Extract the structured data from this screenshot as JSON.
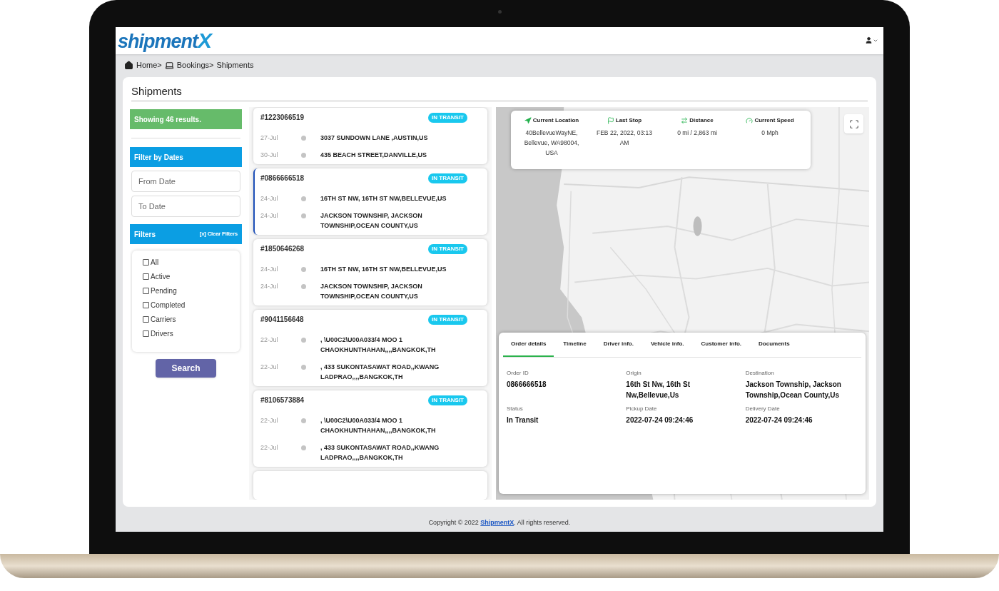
{
  "logo": {
    "text": "shipment",
    "accent": "X"
  },
  "breadcrumb": [
    {
      "kind": "home",
      "label": "Home>"
    },
    {
      "kind": "laptop",
      "label": "Bookings>"
    },
    {
      "kind": "text",
      "label": "Shipments"
    }
  ],
  "page_title": "Shipments",
  "results_banner": "Showing 46 results.",
  "date_filter": {
    "title": "Filter by Dates",
    "fields": [
      {
        "placeholder": "From Date"
      },
      {
        "placeholder": "To Date"
      }
    ]
  },
  "filters": {
    "title": "Filters",
    "clear_link": "[x] Clear Filters",
    "options": [
      {
        "label": "All",
        "checked": false
      },
      {
        "label": "Active",
        "checked": false
      },
      {
        "label": "Pending",
        "checked": false
      },
      {
        "label": "Completed",
        "checked": false
      },
      {
        "label": "Carriers",
        "checked": false
      },
      {
        "label": "Drivers",
        "checked": false
      }
    ]
  },
  "search_button": "Search",
  "shipments": [
    {
      "id": "#1223066519",
      "status": "IN TRANSIT",
      "selected": false,
      "stops": [
        {
          "date": "27-Jul",
          "address": "3037 SUNDOWN LANE ,AUSTIN,US"
        },
        {
          "date": "30-Jul",
          "address": "435 BEACH STREET,DANVILLE,US"
        }
      ]
    },
    {
      "id": "#0866666518",
      "status": "IN TRANSIT",
      "selected": true,
      "stops": [
        {
          "date": "24-Jul",
          "address": "16TH ST NW, 16TH ST NW,BELLEVUE,US"
        },
        {
          "date": "24-Jul",
          "address": "JACKSON TOWNSHIP, JACKSON TOWNSHIP,OCEAN COUNTY,US"
        }
      ]
    },
    {
      "id": "#1850646268",
      "status": "IN TRANSIT",
      "selected": false,
      "stops": [
        {
          "date": "24-Jul",
          "address": "16TH ST NW, 16TH ST NW,BELLEVUE,US"
        },
        {
          "date": "24-Jul",
          "address": "JACKSON TOWNSHIP, JACKSON TOWNSHIP,OCEAN COUNTY,US"
        }
      ]
    },
    {
      "id": "#9041156648",
      "status": "IN TRANSIT",
      "selected": false,
      "stops": [
        {
          "date": "22-Jul",
          "address": ", \\U00C2\\U00A033/4 MOO 1 CHAOKHUNTHAHAN,,,,BANGKOK,TH"
        },
        {
          "date": "22-Jul",
          "address": ", 433 SUKONTASAWAT ROAD,,KWANG LADPRAO,,,,BANGKOK,TH"
        }
      ]
    },
    {
      "id": "#8106573884",
      "status": "IN TRANSIT",
      "selected": false,
      "stops": [
        {
          "date": "22-Jul",
          "address": ", \\U00C2\\U00A033/4 MOO 1 CHAOKHUNTHAHAN,,,,BANGKOK,TH"
        },
        {
          "date": "22-Jul",
          "address": ", 433 SUKONTASAWAT ROAD,,KWANG LADPRAO,,,,BANGKOK,TH"
        }
      ]
    }
  ],
  "tracking": [
    {
      "kind": "location",
      "label": "Current Location",
      "value": "40BellevueWayNE, Bellevue, WA98004, USA"
    },
    {
      "kind": "stop",
      "label": "Last Stop",
      "value": "FEB 22, 2022, 03:13 AM"
    },
    {
      "kind": "distance",
      "label": "Distance",
      "value": "0 mi / 2,863 mi"
    },
    {
      "kind": "speed",
      "label": "Current Speed",
      "value": "0 Mph"
    }
  ],
  "details": {
    "tabs": [
      {
        "label": "Order details",
        "selected": true
      },
      {
        "label": "Timeline",
        "selected": false
      },
      {
        "label": "Driver info.",
        "selected": false
      },
      {
        "label": "Vehicle info.",
        "selected": false
      },
      {
        "label": "Customer info.",
        "selected": false
      },
      {
        "label": "Documents",
        "selected": false
      }
    ],
    "fields": [
      {
        "label": "Order ID",
        "value": "0866666518"
      },
      {
        "label": "Origin",
        "value": "16th St Nw, 16th St Nw,Bellevue,Us"
      },
      {
        "label": "Destination",
        "value": "Jackson Township, Jackson Township,Ocean County,Us"
      },
      {
        "label": "Status",
        "value": "In Transit"
      },
      {
        "label": "Pickup Date",
        "value": "2022-07-24 09:24:46"
      },
      {
        "label": "Delivery Date",
        "value": "2022-07-24 09:24:46"
      }
    ]
  },
  "footer": {
    "prefix": "Copyright © 2022 ",
    "link": "ShipmentX",
    "suffix": ". All rights reserved."
  }
}
